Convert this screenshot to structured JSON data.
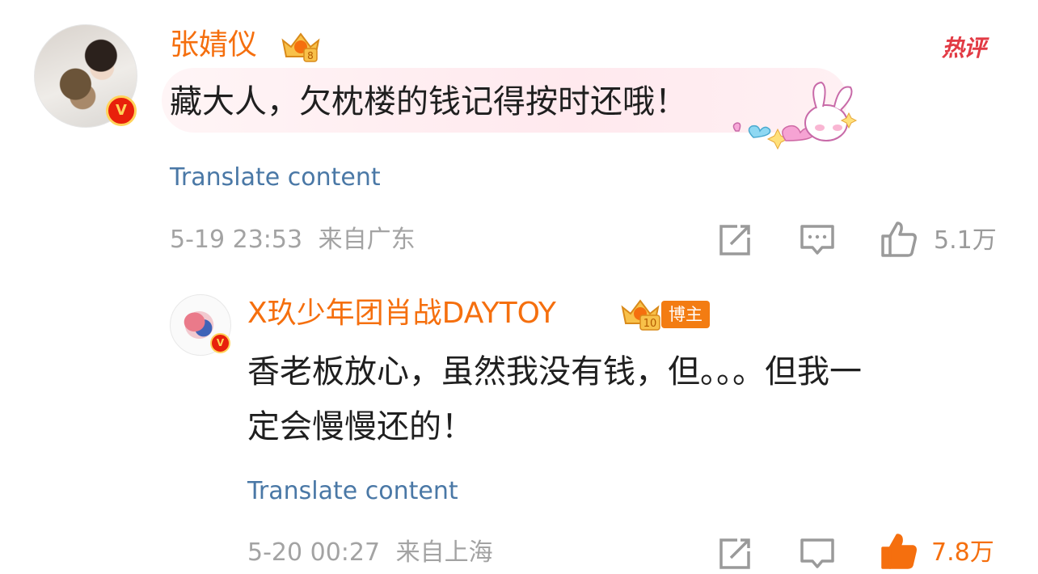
{
  "hot_label": "热评",
  "comment": {
    "username": "张婧仪",
    "crown_level": "8",
    "text": "藏大人，欠枕楼的钱记得按时还哦！",
    "translate": "Translate content",
    "timestamp": "5-19 23:53",
    "location": "来自广东",
    "likes": "5.1万",
    "verified_mark": "V"
  },
  "reply": {
    "username": "X玖少年团肖战DAYTOY",
    "crown_level": "10",
    "badge": "博主",
    "text_line1": "香老板放心，虽然我没有钱，但。。。但我一",
    "text_line2": "定会慢慢还的！",
    "translate": "Translate content",
    "timestamp": "5-20 00:27",
    "location": "来自上海",
    "likes": "7.8万",
    "verified_mark": "V"
  },
  "colors": {
    "username": "#f56f0e",
    "translate_link": "#4a78a6",
    "meta_text": "#a3a3a3",
    "hot_label": "#e23a44",
    "verified_badge": "#e8200b"
  },
  "icons": [
    "share-icon",
    "comment-icon",
    "like-icon",
    "rabbit-sticker",
    "crown-icon",
    "verified-icon"
  ]
}
